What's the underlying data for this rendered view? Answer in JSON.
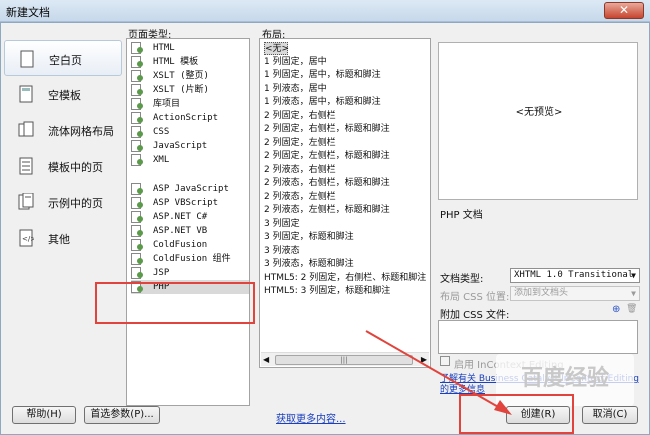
{
  "window": {
    "title": "新建文档",
    "close_glyph": "✕"
  },
  "categories": [
    {
      "label": "空白页",
      "icon": "blank-page-icon",
      "selected": true
    },
    {
      "label": "空模板",
      "icon": "blank-template-icon",
      "selected": false
    },
    {
      "label": "流体网格布局",
      "icon": "fluid-grid-icon",
      "selected": false
    },
    {
      "label": "模板中的页",
      "icon": "template-page-icon",
      "selected": false
    },
    {
      "label": "示例中的页",
      "icon": "sample-page-icon",
      "selected": false
    },
    {
      "label": "其他",
      "icon": "other-icon",
      "selected": false
    }
  ],
  "page_types": {
    "label": "页面类型:",
    "items": [
      {
        "label": "HTML",
        "selected": false
      },
      {
        "label": "HTML 模板",
        "selected": false
      },
      {
        "label": "XSLT (整页)",
        "selected": false
      },
      {
        "label": "XSLT (片断)",
        "selected": false
      },
      {
        "label": "库项目",
        "selected": false
      },
      {
        "label": "ActionScript",
        "selected": false
      },
      {
        "label": "CSS",
        "selected": false
      },
      {
        "label": "JavaScript",
        "selected": false
      },
      {
        "label": "XML",
        "selected": false
      },
      {
        "label": "ASP JavaScript",
        "selected": false
      },
      {
        "label": "ASP VBScript",
        "selected": false
      },
      {
        "label": "ASP.NET C#",
        "selected": false
      },
      {
        "label": "ASP.NET VB",
        "selected": false
      },
      {
        "label": "ColdFusion",
        "selected": false
      },
      {
        "label": "ColdFusion 组件",
        "selected": false
      },
      {
        "label": "JSP",
        "selected": false
      },
      {
        "label": "PHP",
        "selected": true
      }
    ]
  },
  "layouts": {
    "label": "布局:",
    "items": [
      "<无>",
      "1 列固定，居中",
      "1 列固定，居中，标题和脚注",
      "1 列液态，居中",
      "1 列液态，居中，标题和脚注",
      "2 列固定，右侧栏",
      "2 列固定，右侧栏，标题和脚注",
      "2 列固定，左侧栏",
      "2 列固定，左侧栏，标题和脚注",
      "2 列液态，右侧栏",
      "2 列液态，右侧栏，标题和脚注",
      "2 列液态，左侧栏",
      "2 列液态，左侧栏，标题和脚注",
      "3 列固定",
      "3 列固定，标题和脚注",
      "3 列液态",
      "3 列液态，标题和脚注",
      "HTML5: 2 列固定，右侧栏、标题和脚注",
      "HTML5: 3 列固定，标题和脚注"
    ],
    "scroll_grip": "|||"
  },
  "preview": {
    "text": "<无预览>",
    "description": "PHP 文档"
  },
  "doctype": {
    "label": "文档类型:",
    "value": "XHTML 1.0 Transitional",
    "arrow": "▼"
  },
  "layout_css": {
    "label": "布局 CSS 位置:",
    "value": "添加到文档头",
    "arrow": "▼"
  },
  "attach_css": {
    "label": "附加 CSS 文件:",
    "link_glyph": "⊕",
    "trash_glyph": "🗑"
  },
  "incontext": {
    "label": "启用 InContext Editing",
    "link": "了解有关 Business Catalyst InContext Editing 的更多信息"
  },
  "buttons": {
    "help": "帮助(H)",
    "prefs": "首选参数(P)...",
    "more_content": "获取更多内容...",
    "create": "创建(R)",
    "cancel": "取消(C)"
  },
  "watermark": "百度经验"
}
